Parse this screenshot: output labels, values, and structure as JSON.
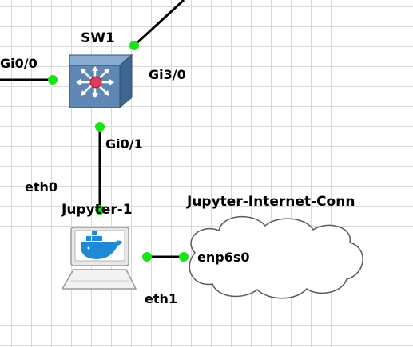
{
  "nodes": {
    "switch": {
      "label": "SW1",
      "icon": "ethernet-switch-icon"
    },
    "host": {
      "label": "Jupyter-1",
      "icon": "docker-host-icon"
    },
    "cloud": {
      "label": "Jupyter-Internet-Conn",
      "icon": "cloud-icon",
      "port_label": "enp6s0"
    }
  },
  "ports": {
    "sw_left": "Gi0/0",
    "sw_right": "Gi3/0",
    "sw_down": "Gi0/1",
    "host_up": "eth0",
    "host_right": "eth1"
  },
  "colors": {
    "link": "#000000",
    "port_up": "#19e319",
    "switch_body": "#5f87b4",
    "switch_center": "#e03a5a",
    "docker_blue": "#1e8ad6"
  }
}
